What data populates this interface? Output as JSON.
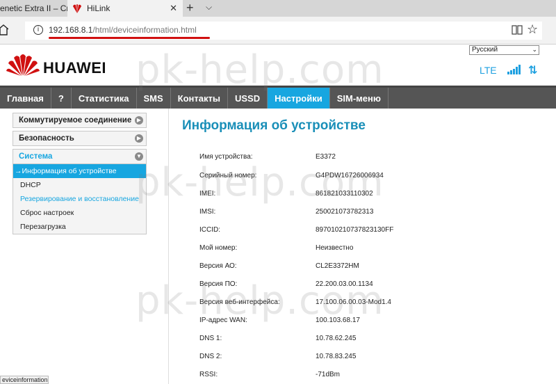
{
  "browser": {
    "tab1_title": "enetic Extra II – Сис",
    "tab2_title": "HiLink",
    "url_host": "192.168.8.1",
    "url_path": "/html/deviceinformation.html",
    "status_url": "eviceinformation.html"
  },
  "header": {
    "brand": "HUAWEI",
    "language": "Русский",
    "network_type": "LTE",
    "accent_color": "#17a6e0",
    "logo_color": "#d01010"
  },
  "nav": {
    "items": [
      {
        "label": "Главная"
      },
      {
        "label": "?"
      },
      {
        "label": "Статистика"
      },
      {
        "label": "SMS"
      },
      {
        "label": "Контакты"
      },
      {
        "label": "USSD"
      },
      {
        "label": "Настройки"
      },
      {
        "label": "SIM-меню"
      }
    ],
    "active_index": 6
  },
  "sidebar": {
    "groups": [
      {
        "label": "Коммутируемое соединение"
      },
      {
        "label": "Безопасность"
      },
      {
        "label": "Система"
      }
    ],
    "sub_items": [
      {
        "label": "Информация об устройстве"
      },
      {
        "label": "DHCP"
      },
      {
        "label": "Резервирование и восстановление"
      },
      {
        "label": "Сброс настроек"
      },
      {
        "label": "Перезагрузка"
      }
    ]
  },
  "content": {
    "title": "Информация об устройстве",
    "rows": [
      {
        "label": "Имя устройства:",
        "value": "E3372"
      },
      {
        "label": "Серийный номер:",
        "value": "G4PDW16726006934"
      },
      {
        "label": "IMEI:",
        "value": "861821033110302"
      },
      {
        "label": "IMSI:",
        "value": "250021073782313"
      },
      {
        "label": "ICCID:",
        "value": "897010210737823130FF"
      },
      {
        "label": "Мой номер:",
        "value": "Неизвестно"
      },
      {
        "label": "Версия АО:",
        "value": "CL2E3372HM"
      },
      {
        "label": "Версия ПО:",
        "value": "22.200.03.00.1134"
      },
      {
        "label": "Версия веб-интерфейса:",
        "value": "17.100.06.00.03-Mod1.4"
      },
      {
        "label": "IP-адрес WAN:",
        "value": "100.103.68.17"
      },
      {
        "label": "DNS 1:",
        "value": "10.78.62.245"
      },
      {
        "label": "DNS 2:",
        "value": "10.78.83.245"
      },
      {
        "label": "RSSI:",
        "value": "-71dBm"
      }
    ]
  },
  "watermark": "pk-help.com"
}
